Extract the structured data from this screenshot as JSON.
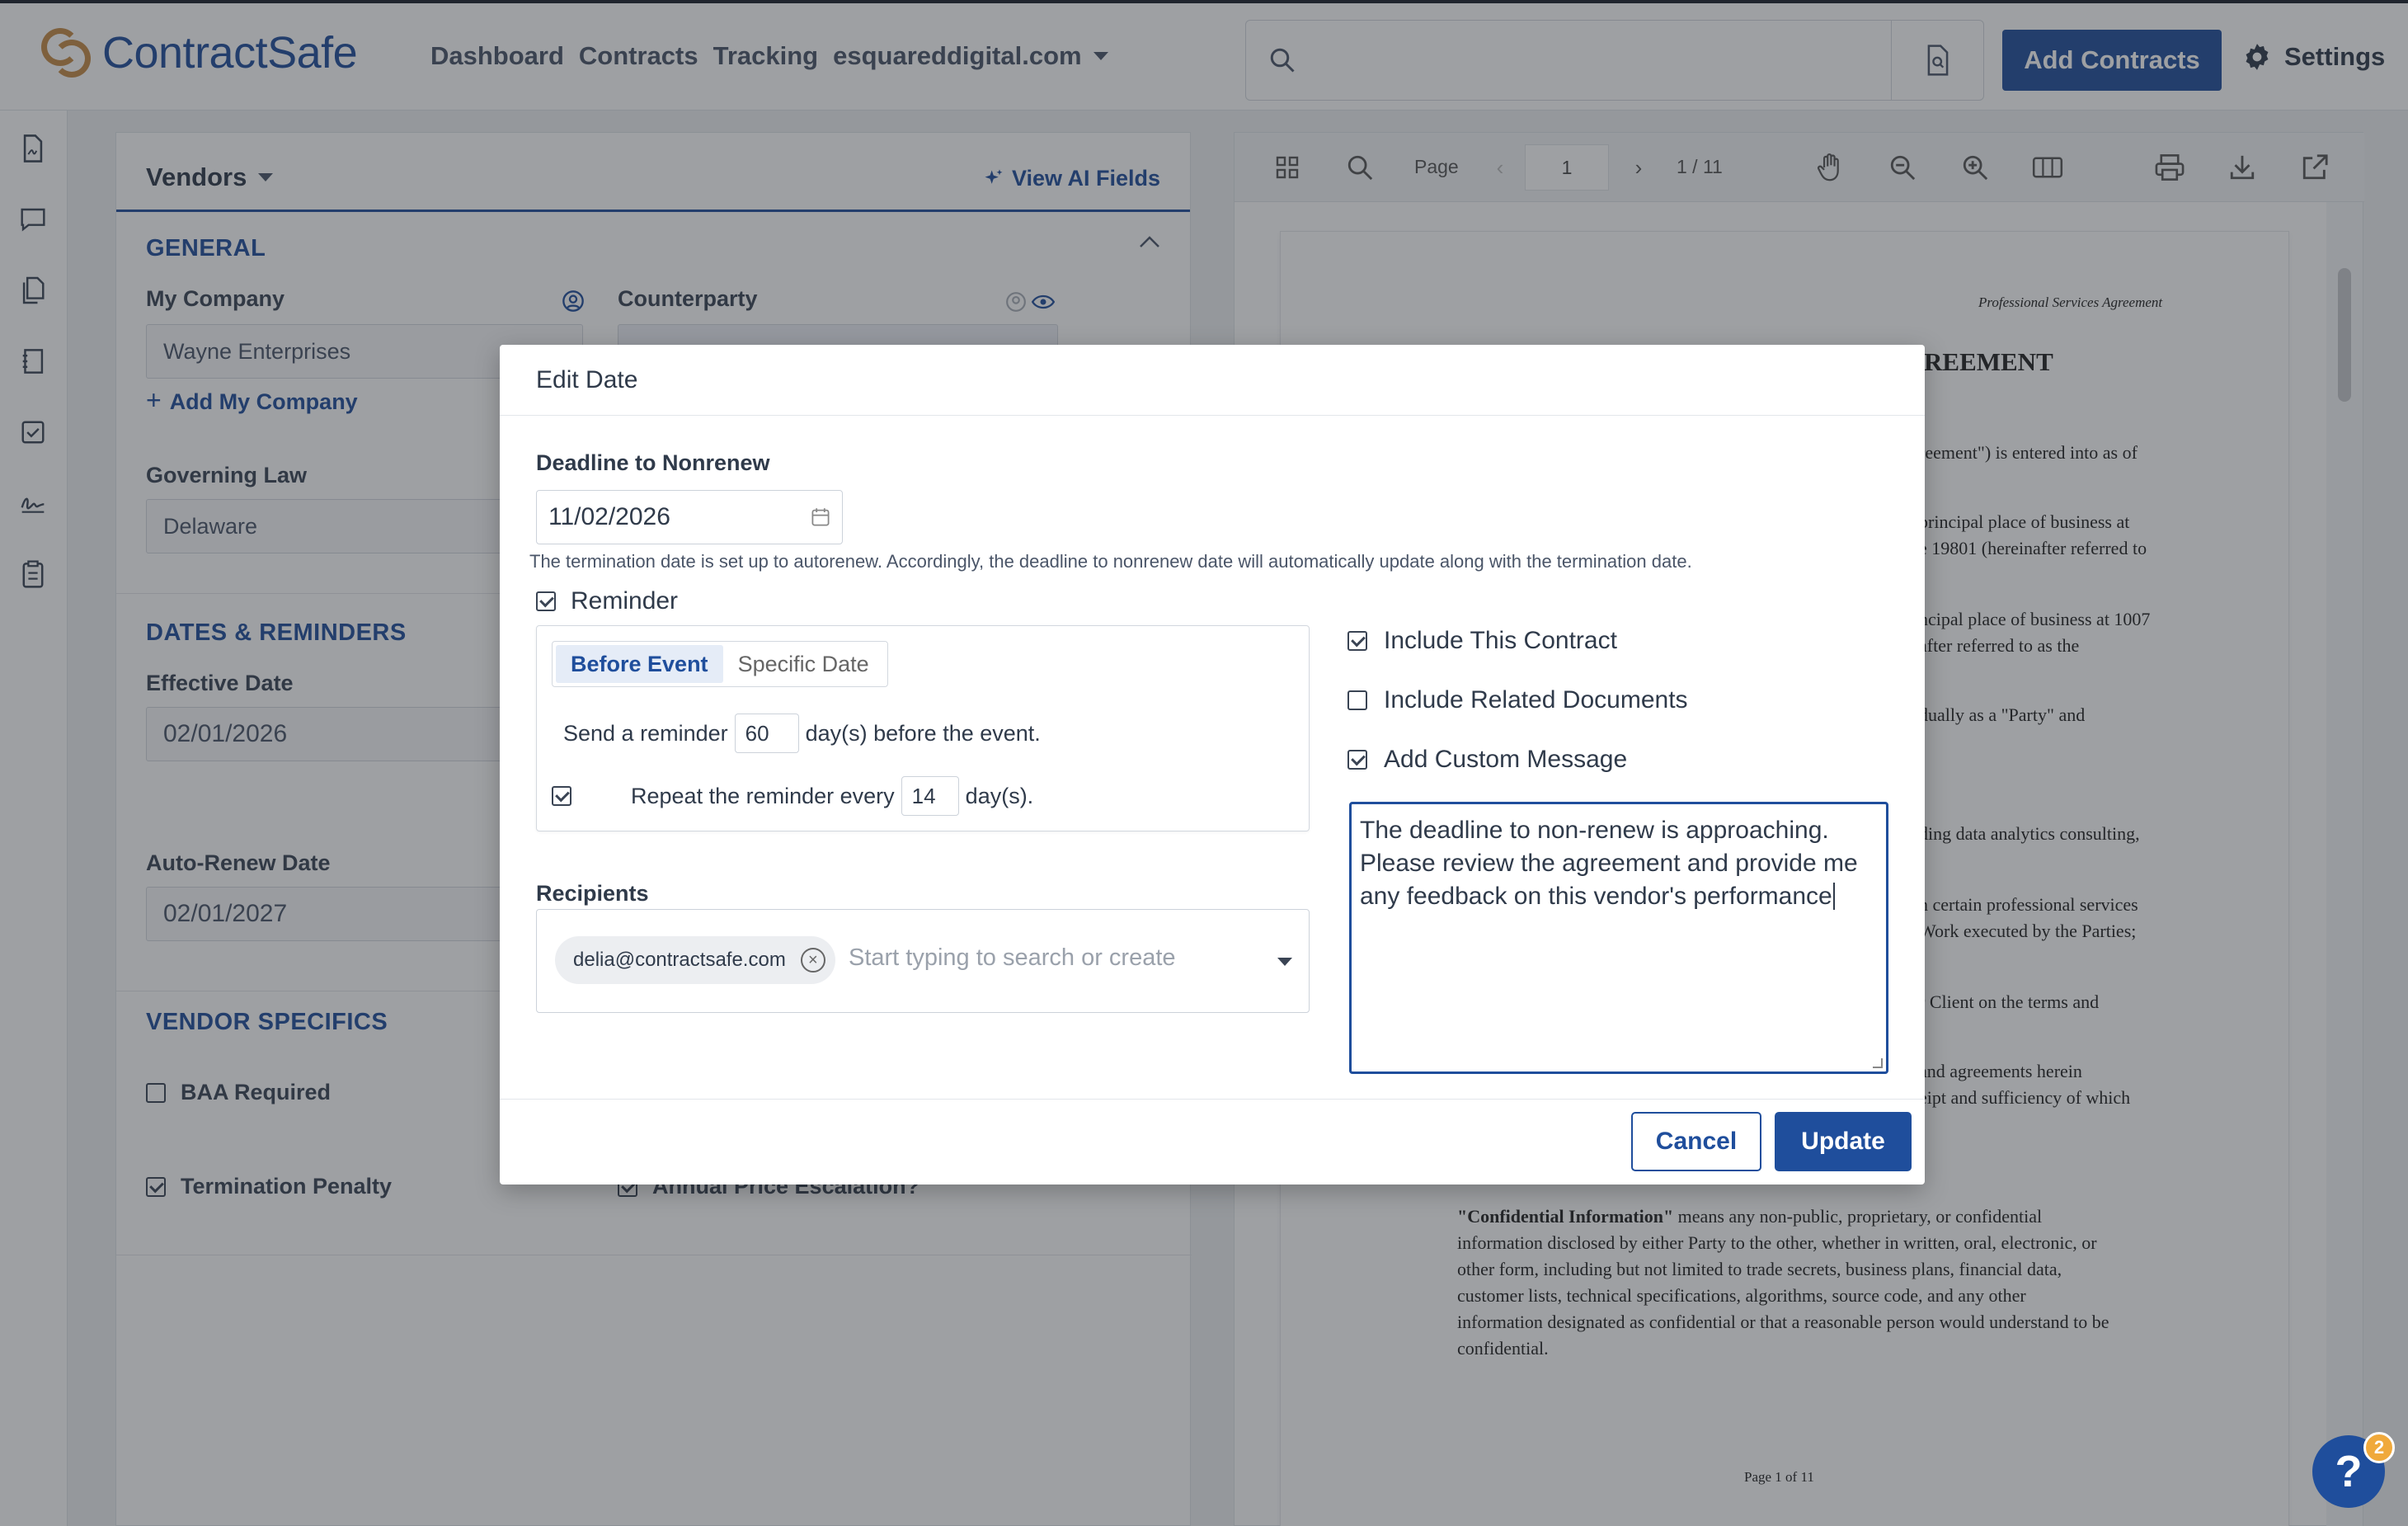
{
  "header": {
    "logo_text": "ContractSafe",
    "nav": [
      "Dashboard",
      "Contracts",
      "Tracking"
    ],
    "org_name": "esquareddigital.com",
    "add_contracts_label": "Add Contracts",
    "settings_label": "Settings"
  },
  "form": {
    "selector_label": "Vendors",
    "view_ai_label": "View AI Fields",
    "general_title": "GENERAL",
    "my_company_label": "My Company",
    "my_company_value": "Wayne Enterprises",
    "add_my_company_label": "Add My Company",
    "counterparty_label": "Counterparty",
    "governing_law_label": "Governing Law",
    "governing_law_value": "Delaware",
    "dates_title": "DATES & REMINDERS",
    "effective_date_label": "Effective Date",
    "effective_date_value": "02/01/2026",
    "auto_renew_label": "Auto-Renew Date",
    "auto_renew_value": "02/01/2027",
    "vendor_title": "VENDOR SPECIFICS",
    "baa_label": "BAA Required",
    "termination_penalty_label": "Termination Penalty",
    "annual_price_label": "Annual Price Escalation?"
  },
  "viewer": {
    "page_label": "Page",
    "page_value": "1",
    "page_count": "1 / 11",
    "doc_header": "Professional Services Agreement",
    "doc_title_fragment": "REEMENT",
    "doc_lines": [
      "reement\") is entered into as of",
      "principal place of business at",
      "e 19801 (hereinafter referred to",
      "ncipal place of business at 1007",
      "after referred to as the",
      "dually as a \"Party\" and",
      "ding data analytics consulting,",
      "n certain professional services",
      "Work executed by the Parties;",
      "r Client on the terms and",
      "and agreements herein",
      "eipt and sufficiency of which"
    ],
    "confidential_term": "\"Confidential Information\"",
    "confidential_lines": [
      " means any non-public, proprietary, or confidential",
      "information disclosed by either Party to the other, whether in written, oral, electronic, or",
      "other form, including but not limited to trade secrets, business plans, financial data,",
      "customer lists, technical specifications, algorithms, source code, and any other",
      "information designated as confidential or that a reasonable person would understand to be",
      "confidential."
    ],
    "page_footer": "Page 1 of 11"
  },
  "modal": {
    "title": "Edit Date",
    "deadline_label": "Deadline to Nonrenew",
    "deadline_value": "11/02/2026",
    "hint": "The termination date is set up to autorenew. Accordingly, the deadline to nonrenew date will automatically update along with the termination date.",
    "reminder_label": "Reminder",
    "tab_before": "Before Event",
    "tab_specific": "Specific Date",
    "send_prefix": "Send a reminder",
    "send_days": "60",
    "send_suffix": "day(s) before the event.",
    "repeat_prefix": "Repeat the reminder every",
    "repeat_days": "14",
    "repeat_suffix": "day(s).",
    "recipients_label": "Recipients",
    "recipient_chip": "delia@contractsafe.com",
    "recipient_placeholder": "Start typing to search or create",
    "include_contract_label": "Include This Contract",
    "include_related_label": "Include Related Documents",
    "add_custom_label": "Add Custom Message",
    "custom_message": "The deadline to non-renew is approaching. Please review the agreement and provide me any feedback on this vendor's performance",
    "cancel_label": "Cancel",
    "update_label": "Update"
  },
  "help": {
    "symbol": "?",
    "badge_count": "2"
  },
  "colors": {
    "brand": "#1f4e9c",
    "logo_accent": "#c58a45",
    "badge": "#f0a93b"
  }
}
